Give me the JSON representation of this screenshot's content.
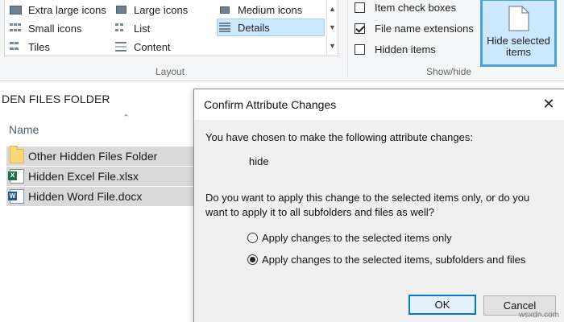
{
  "ribbon": {
    "layout_options": [
      {
        "label": "Extra large icons",
        "icon": "extra-large-icons-icon"
      },
      {
        "label": "Large icons",
        "icon": "large-icons-icon"
      },
      {
        "label": "Medium icons",
        "icon": "medium-icons-icon"
      },
      {
        "label": "Small icons",
        "icon": "small-icons-icon"
      },
      {
        "label": "List",
        "icon": "list-icon"
      },
      {
        "label": "Details",
        "icon": "details-icon",
        "selected": true
      },
      {
        "label": "Tiles",
        "icon": "tiles-icon"
      },
      {
        "label": "Content",
        "icon": "content-icon"
      }
    ],
    "layout_group_label": "Layout",
    "show_hide": {
      "checkboxes": [
        {
          "label": "Item check boxes",
          "checked": false
        },
        {
          "label": "File name extensions",
          "checked": true
        },
        {
          "label": "Hidden items",
          "checked": false
        }
      ],
      "group_label": "Show/hide",
      "hide_button_label_line1": "Hide selected",
      "hide_button_label_line2": "items"
    }
  },
  "pane": {
    "breadcrumb": "DEN FILES FOLDER",
    "column_header": "Name",
    "files": [
      {
        "name": "Other Hidden Files Folder",
        "icon": "folder-icon"
      },
      {
        "name": "Hidden Excel File.xlsx",
        "icon": "excel-file-icon"
      },
      {
        "name": "Hidden Word File.docx",
        "icon": "word-file-icon"
      }
    ]
  },
  "dialog": {
    "title": "Confirm Attribute Changes",
    "intro": "You have chosen to make the following attribute changes:",
    "change": "hide",
    "question_line1": "Do you want to apply this change to the selected items only, or do you",
    "question_line2": "want to apply it to all subfolders and files as well?",
    "options": [
      {
        "label": "Apply changes to the selected items only",
        "selected": false
      },
      {
        "label": "Apply changes to the selected items, subfolders and files",
        "selected": true
      }
    ],
    "ok_label": "OK",
    "cancel_label": "Cancel"
  },
  "watermark": "wsxdn.com",
  "colors": {
    "selection": "#cce8ff",
    "accent_border": "#4aa3df",
    "default_button_border": "#0078d7"
  }
}
